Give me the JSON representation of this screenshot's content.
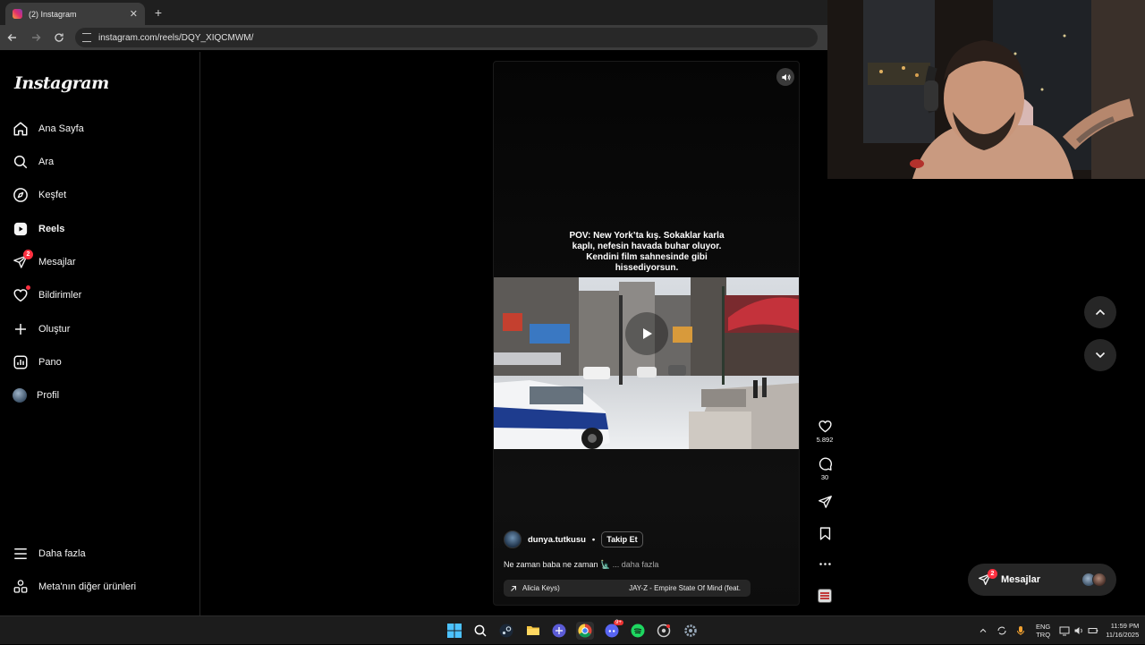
{
  "browser": {
    "tab_title": "(2) Instagram",
    "tab_close": "✕",
    "new_tab": "+",
    "url": "instagram.com/reels/DQY_XIQCMWM/"
  },
  "sidebar": {
    "logo": "Instagram",
    "items": [
      {
        "label": "Ana Sayfa",
        "icon": "home-icon"
      },
      {
        "label": "Ara",
        "icon": "search-icon"
      },
      {
        "label": "Keşfet",
        "icon": "compass-icon"
      },
      {
        "label": "Reels",
        "icon": "reels-icon"
      },
      {
        "label": "Mesajlar",
        "icon": "messenger-icon",
        "badge": "2"
      },
      {
        "label": "Bildirimler",
        "icon": "heart-icon"
      },
      {
        "label": "Oluştur",
        "icon": "plus-icon"
      },
      {
        "label": "Pano",
        "icon": "dashboard-icon"
      },
      {
        "label": "Profil",
        "icon": "avatar"
      }
    ],
    "more": "Daha fazla",
    "meta": "Meta'nın diğer ürünleri"
  },
  "reel": {
    "overlay_caption": "POV: New York’ta kış. Sokaklar karla kaplı, nefesin havada buhar oluyor. Kendini film sahnesinde gibi hissediyorsun.",
    "author": "dunya.tutkusu",
    "separator": "•",
    "follow": "Takip Et",
    "description": "Ne zaman baba ne zaman 🗽",
    "more": "... daha fazla",
    "music_artist": "Alicia Keys)",
    "music_track": "JAY-Z - Empire State Of Mind (feat.",
    "likes": "5.892",
    "comments": "30"
  },
  "messages_pill": {
    "label": "Mesajlar",
    "badge": "2"
  },
  "taskbar": {
    "lang_top": "ENG",
    "lang_bottom": "TRQ",
    "time": "11:59 PM",
    "date": "11/16/2025",
    "spotify_badge": "9+"
  },
  "colors": {
    "accent_red": "#ff3040",
    "panel": "#262626",
    "background": "#000000"
  }
}
